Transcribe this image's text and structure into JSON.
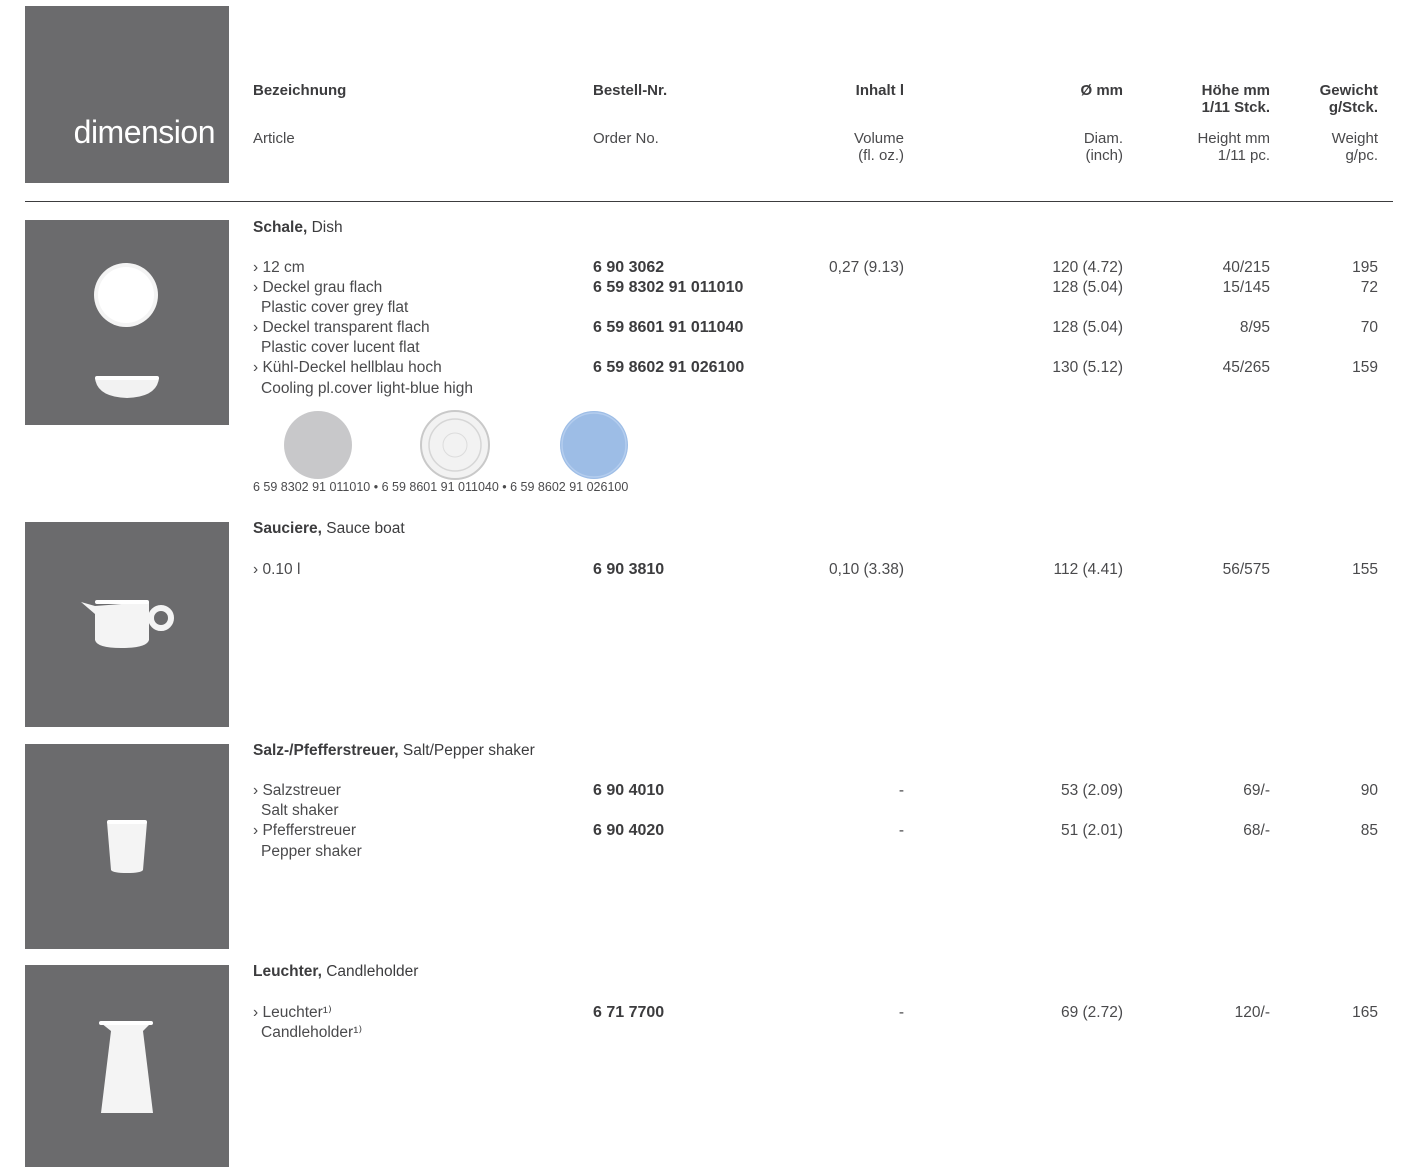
{
  "logo": "dimension",
  "header": {
    "col_article_de": "Bezeichnung",
    "col_article_en": "Article",
    "col_order_de": "Bestell-Nr.",
    "col_order_en": "Order No.",
    "col_volume_de": "Inhalt l",
    "col_volume_en_1": "Volume",
    "col_volume_en_2": "(fl. oz.)",
    "col_diam_de": "Ø mm",
    "col_diam_en_1": "Diam.",
    "col_diam_en_2": "(inch)",
    "col_height_de_1": "Höhe mm",
    "col_height_de_2": "1/11 Stck.",
    "col_height_en_1": "Height mm",
    "col_height_en_2": "1/11 pc.",
    "col_weight_de_1": "Gewicht",
    "col_weight_de_2": "g/Stck.",
    "col_weight_en_1": "Weight",
    "col_weight_en_2": "g/pc."
  },
  "sections": [
    {
      "title_de": "Schale,",
      "title_en": " Dish",
      "rows": [
        {
          "name": "› 12 cm",
          "sub": "",
          "order": "6 90 3062",
          "volume": "0,27 (9.13)",
          "diam": "120 (4.72)",
          "height": "40/215",
          "weight": "195"
        },
        {
          "name": "› Deckel grau flach",
          "sub": "Plastic cover grey flat",
          "order": "6 59 8302 91 011010",
          "volume": "",
          "diam": "128 (5.04)",
          "height": "15/145",
          "weight": "72"
        },
        {
          "name": "› Deckel transparent flach",
          "sub": "Plastic cover lucent flat",
          "order": "6 59 8601 91 011040",
          "volume": "",
          "diam": "128 (5.04)",
          "height": "8/95",
          "weight": "70"
        },
        {
          "name": "› Kühl-Deckel hellblau hoch",
          "sub": "Cooling pl.cover light-blue high",
          "order": "6 59 8602 91 026100",
          "volume": "",
          "diam": "130 (5.12)",
          "height": "45/265",
          "weight": "159"
        }
      ],
      "caption": "6 59 8302 91 011010 • 6 59 8601 91 011040 • 6 59 8602 91 026100"
    },
    {
      "title_de": "Sauciere,",
      "title_en": " Sauce boat",
      "rows": [
        {
          "name": "› 0.10 l",
          "sub": "",
          "order": "6 90 3810",
          "volume": "0,10 (3.38)",
          "diam": "112 (4.41)",
          "height": "56/575",
          "weight": "155"
        }
      ]
    },
    {
      "title_de": "Salz-/Pfefferstreuer,",
      "title_en": " Salt/Pepper shaker",
      "rows": [
        {
          "name": "› Salzstreuer",
          "sub": "Salt shaker",
          "order": "6 90 4010",
          "volume": "-",
          "diam": "53 (2.09)",
          "height": "69/-",
          "weight": "90"
        },
        {
          "name": "› Pfefferstreuer",
          "sub": "Pepper shaker",
          "order": "6 90 4020",
          "volume": "-",
          "diam": "51 (2.01)",
          "height": "68/-",
          "weight": "85"
        }
      ]
    },
    {
      "title_de": "Leuchter,",
      "title_en": " Candleholder",
      "rows": [
        {
          "name": "› Leuchter¹⁾",
          "sub": "Candleholder¹⁾",
          "order": "6 71 7700",
          "volume": "-",
          "diam": "69 (2.72)",
          "height": "120/-",
          "weight": "165"
        }
      ]
    }
  ],
  "colors": {
    "thumb_bg": "#6b6b6d",
    "lid_grey": "#c8c8ca",
    "lid_blue": "#9dbde6"
  }
}
